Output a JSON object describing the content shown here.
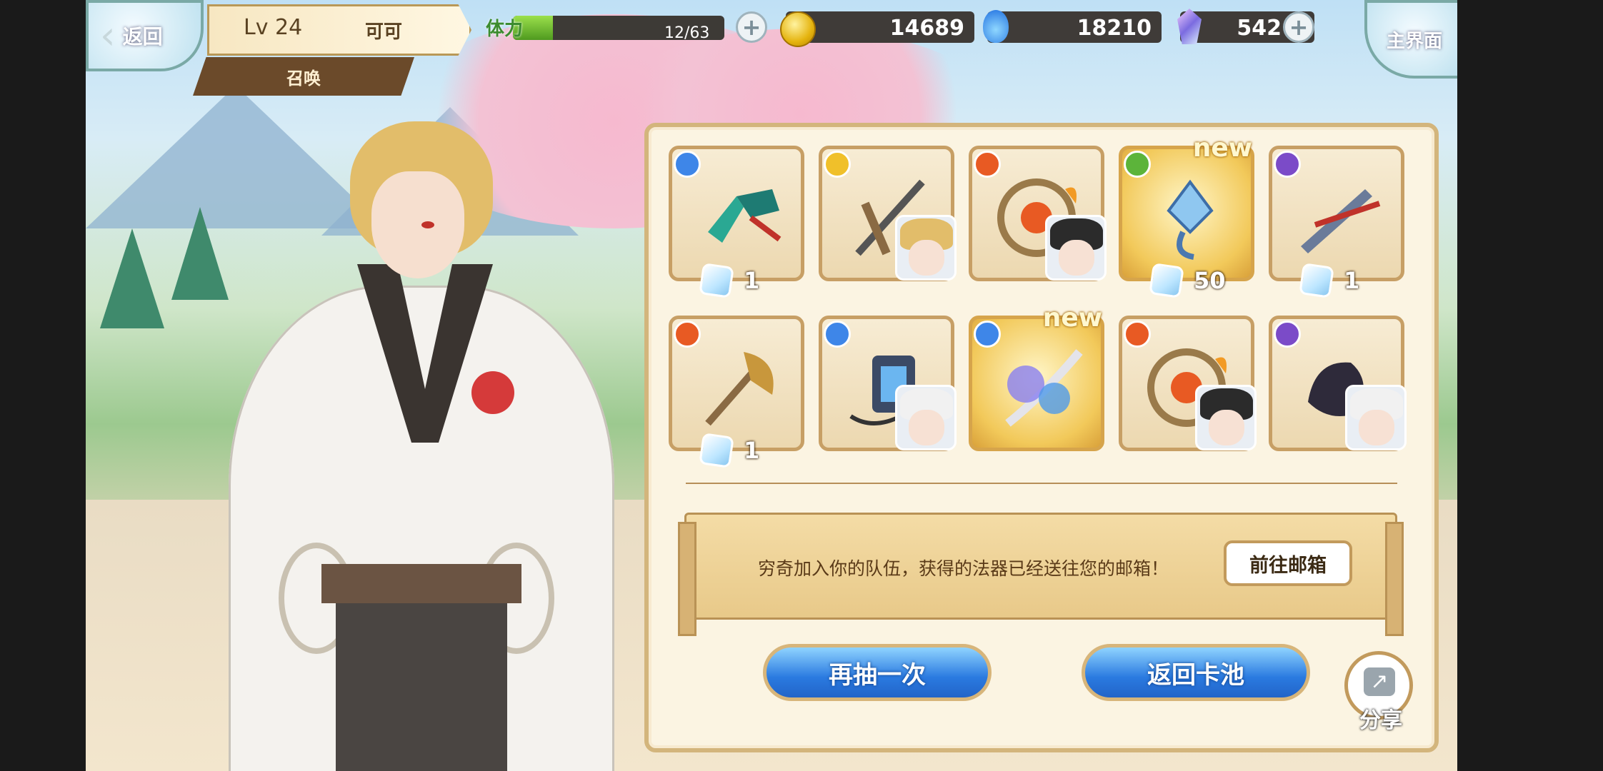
{
  "topbar": {
    "back_label": "返回",
    "home_label": "主界面",
    "player": {
      "level": "Lv 24",
      "name": "可可"
    },
    "tab_label": "召唤",
    "stamina": {
      "label": "体力",
      "current": 12,
      "max": 63,
      "text": "12/63"
    },
    "coins": "14689",
    "souls": "18210",
    "crystals": "542"
  },
  "results": [
    {
      "element": "water",
      "count": "1"
    },
    {
      "element": "light"
    },
    {
      "element": "fire"
    },
    {
      "element": "wood",
      "new": "new",
      "count": "50"
    },
    {
      "element": "dark",
      "count": "1"
    },
    {
      "element": "fire",
      "count": "1"
    },
    {
      "element": "water"
    },
    {
      "element": "water",
      "new": "new"
    },
    {
      "element": "fire"
    },
    {
      "element": "dark"
    }
  ],
  "message": {
    "text": "穷奇加入你的队伍，获得的法器已经送往您的邮箱！",
    "mail_button": "前往邮箱"
  },
  "actions": {
    "draw_again": "再抽一次",
    "return_pool": "返回卡池",
    "share": "分享"
  },
  "colors": {
    "accent_blue": "#2a7ae0",
    "panel_border": "#d3b57c",
    "stamina_green": "#4f9a1f"
  }
}
